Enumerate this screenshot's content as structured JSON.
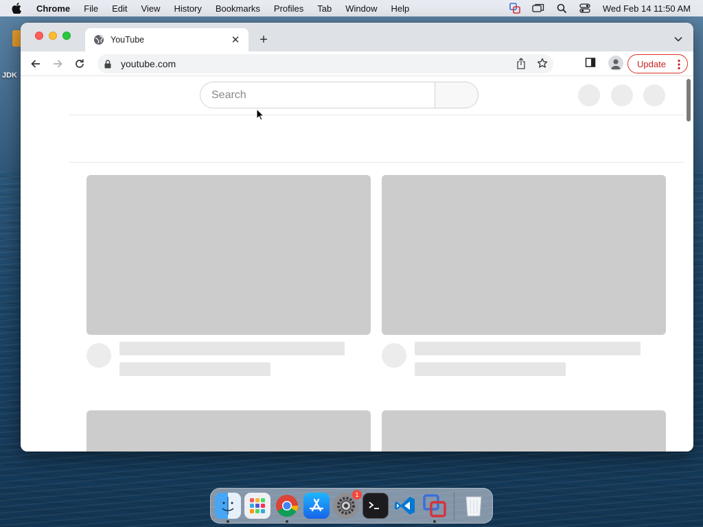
{
  "menubar": {
    "app_name": "Chrome",
    "items": [
      "File",
      "Edit",
      "View",
      "History",
      "Bookmarks",
      "Profiles",
      "Tab",
      "Window",
      "Help"
    ],
    "clock": "Wed Feb 14  11:50 AM"
  },
  "desktop": {
    "label": "JDK"
  },
  "browser": {
    "tab": {
      "title": "YouTube",
      "close_symbol": "✕"
    },
    "new_tab_symbol": "+",
    "address": "youtube.com",
    "update_label": "Update"
  },
  "youtube": {
    "search_placeholder": "Search"
  },
  "dock": {
    "apps": [
      "Finder",
      "Launchpad",
      "Google Chrome",
      "App Store",
      "System Preferences",
      "Terminal",
      "Visual Studio Code",
      "VMware Fusion",
      "Trash"
    ],
    "system_preferences_badge": "1"
  },
  "colors": {
    "accent_update": "#d93025",
    "skeleton_thumbnail": "#cccccc",
    "skeleton_line": "#e6e6e6"
  }
}
